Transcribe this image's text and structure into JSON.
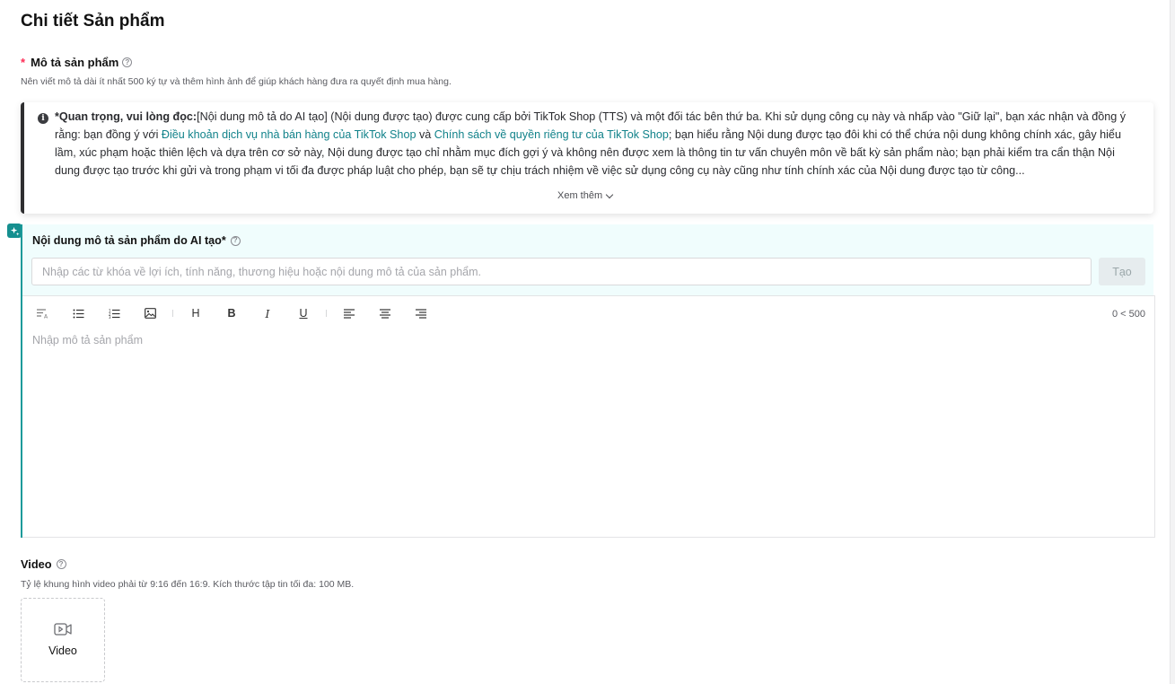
{
  "page": {
    "title": "Chi tiết Sản phẩm"
  },
  "description": {
    "required_mark": "*",
    "label": "Mô tả sản phẩm",
    "hint": "Nên viết mô tả dài ít nhất 500 ký tự và thêm hình ảnh để giúp khách hàng đưa ra quyết định mua hàng."
  },
  "notice": {
    "bold_prefix": "*Quan trọng, vui lòng đọc:",
    "text_1": "[Nội dung mô tả do AI tạo] (Nội dung được tạo) được cung cấp bởi TikTok Shop (TTS) và một đối tác bên thứ ba. Khi sử dụng công cụ này và nhấp vào \"Giữ lại\", bạn xác nhận và đồng ý rằng: bạn đồng ý với ",
    "link_1": "Điều khoản dịch vụ nhà bán hàng của TikTok Shop",
    "text_2": " và ",
    "link_2": "Chính sách về quyền riêng tư của TikTok Shop",
    "text_3": "; bạn hiểu rằng Nội dung được tạo đôi khi có thể chứa nội dung không chính xác, gây hiểu lầm, xúc phạm hoặc thiên lệch và dựa trên cơ sở này, Nội dung được tạo chỉ nhằm mục đích gợi ý và không nên được xem là thông tin tư vấn chuyên môn về bất kỳ sản phẩm nào; bạn phải kiểm tra cẩn thận Nội dung được tạo trước khi gửi và trong phạm vi tối đa được pháp luật cho phép, bạn sẽ tự chịu trách nhiệm về việc sử dụng công cụ này cũng như tính chính xác của Nội dung được tạo từ công...",
    "see_more": "Xem thêm"
  },
  "ai": {
    "label": "Nội dung mô tả sản phẩm do AI tạo*",
    "input_placeholder": "Nhập các từ khóa về lợi ích, tính năng, thương hiệu hoặc nội dung mô tả của sản phẩm.",
    "generate_label": "Tạo"
  },
  "editor": {
    "counter": "0 < 500",
    "placeholder": "Nhập mô tả sản phẩm",
    "heading_label": "H",
    "bold_label": "B",
    "italic_label": "I",
    "underline_label": "U"
  },
  "video": {
    "label": "Video",
    "hint": "Tỷ lệ khung hình video phải từ 9:16 đến 16:9. Kích thước tập tin tối đa: 100 MB.",
    "upload_label": "Video"
  }
}
